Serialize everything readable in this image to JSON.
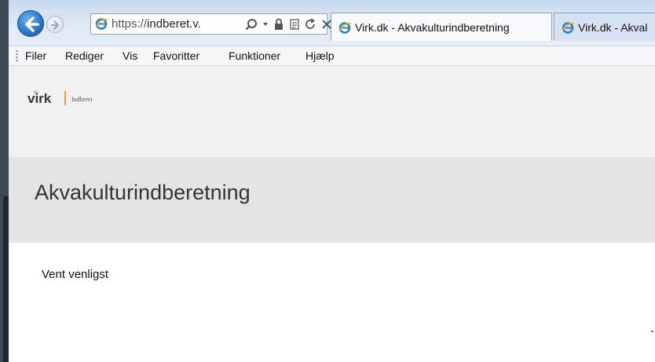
{
  "browser": {
    "address": {
      "protocol": "https://",
      "host": "indberet.v."
    },
    "tabs": [
      {
        "label": "Virk.dk - Akvakulturindberetning"
      },
      {
        "label": "Virk.dk - Akval"
      }
    ],
    "menu": [
      "Filer",
      "Rediger",
      "Vis",
      "Favoritter",
      "Funktioner",
      "Hjælp"
    ]
  },
  "header": {
    "logo_text": "virk",
    "logo_sub": "Indberet"
  },
  "page": {
    "title": "Akvakulturindberetning",
    "status": "Vent venligst"
  },
  "colors": {
    "logo_accent": "#e8a13a",
    "header_bg": "#f1f1f1",
    "banner_bg": "#e4e4e4"
  },
  "icons": [
    "back-arrow-icon",
    "forward-arrow-icon",
    "ie-icon",
    "search-icon",
    "dropdown-icon",
    "lock-icon",
    "compat-icon",
    "refresh-icon",
    "stop-icon"
  ]
}
